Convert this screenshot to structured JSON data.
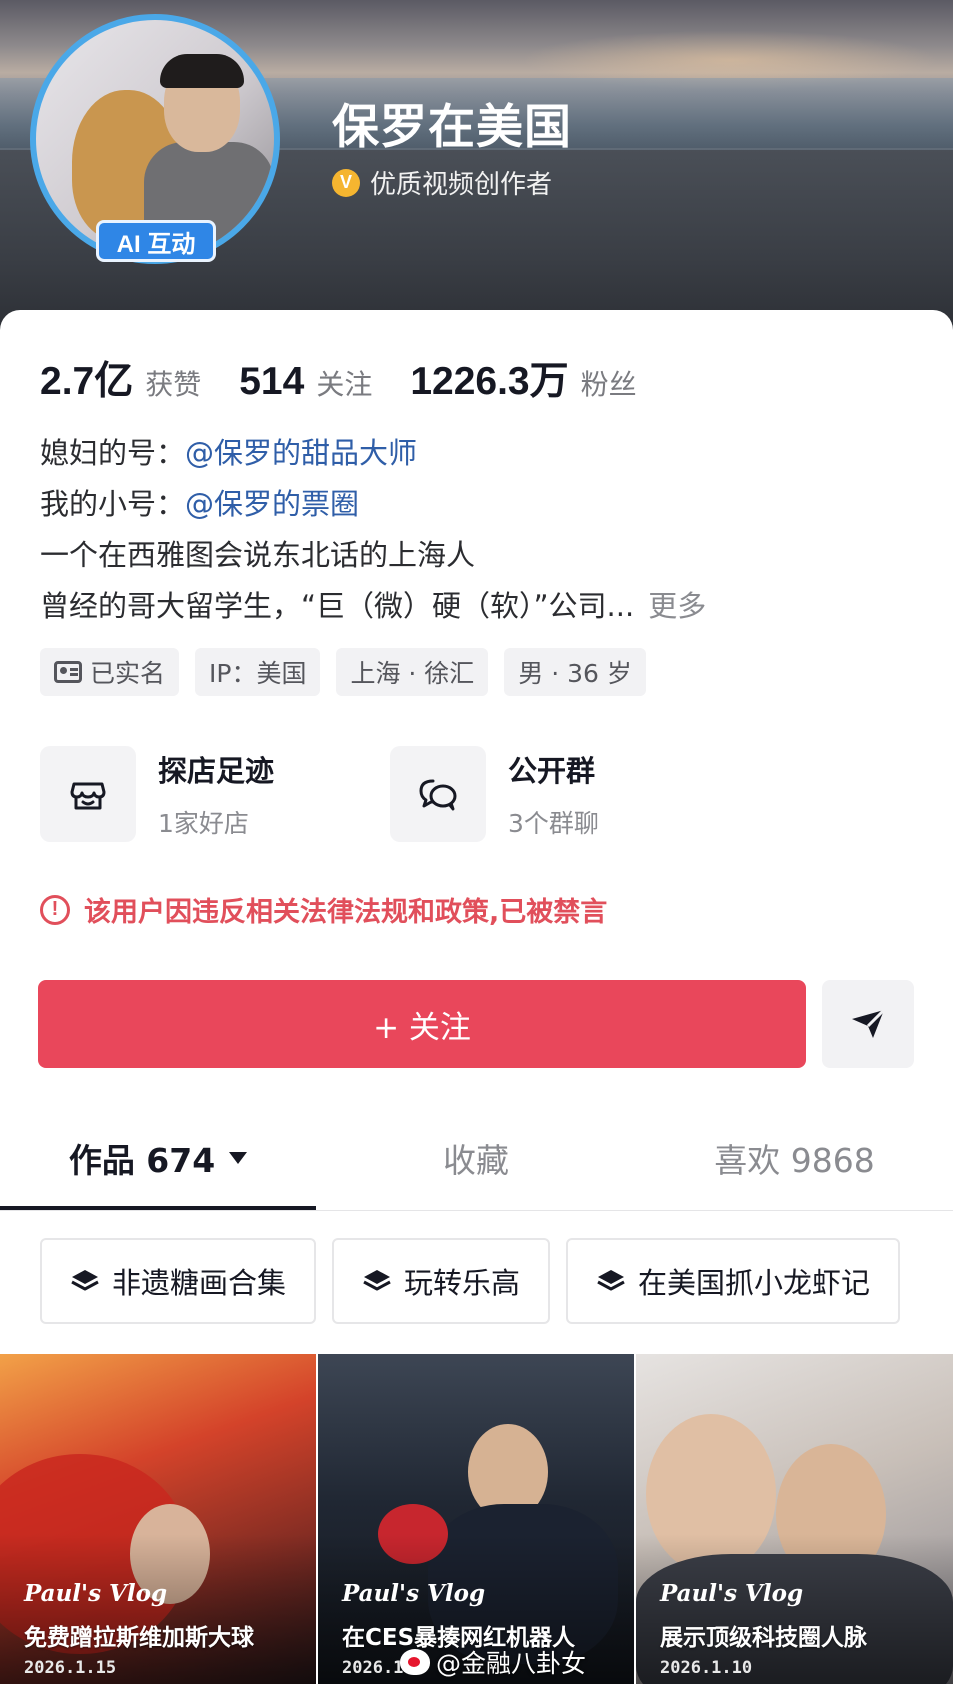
{
  "profile": {
    "nickname": "保罗在美国",
    "ai_badge": "AI 互动",
    "verification": "优质视频创作者",
    "verify_icon_letter": "V"
  },
  "stats": [
    {
      "value": "2.7亿",
      "label": "获赞"
    },
    {
      "value": "514",
      "label": "关注"
    },
    {
      "value": "1226.3万",
      "label": "粉丝"
    }
  ],
  "bio": {
    "line1_prefix": "媳妇的号：",
    "line1_mention": "@保罗的甜品大师",
    "line2_prefix": "我的小号：",
    "line2_mention": "@保罗的票圈",
    "line3": "一个在西雅图会说东北话的上海人",
    "line4": "曾经的哥大留学生，“巨（微）硬（软）”公司...",
    "more": "更多"
  },
  "tags": [
    "已实名",
    "IP：美国",
    "上海 · 徐汇",
    "男 · 36 岁"
  ],
  "entries": [
    {
      "title": "探店足迹",
      "subtitle": "1家好店",
      "icon": "store-icon"
    },
    {
      "title": "公开群",
      "subtitle": "3个群聊",
      "icon": "group-chat-icon"
    }
  ],
  "notice": {
    "icon": "alert-circle-icon",
    "text": "该用户因违反相关法律法规和政策,已被禁言"
  },
  "follow_button": "+ 关注",
  "tabs": [
    {
      "label": "作品 674",
      "active": true
    },
    {
      "label": "收藏",
      "active": false
    },
    {
      "label": "喜欢 9868",
      "active": false
    }
  ],
  "collections": [
    "非遗糖画合集",
    "玩转乐高",
    "在美国抓小龙虾记"
  ],
  "videos": [
    {
      "tag": "Paul's Vlog",
      "title": "免费蹭拉斯维加斯大球",
      "date": "2026.1.15"
    },
    {
      "tag": "Paul's Vlog",
      "title": "在CES暴揍网红机器人",
      "date": "2026.1.1"
    },
    {
      "tag": "Paul's Vlog",
      "title": "展示顶级科技圈人脉",
      "date": "2026.1.10"
    }
  ],
  "watermark": "@金融八卦女",
  "colors": {
    "accent_red": "#e9475b",
    "notice_red": "#e14f5b",
    "mention_blue": "#2f5ea8",
    "avatar_ring": "#4aa8e8"
  }
}
